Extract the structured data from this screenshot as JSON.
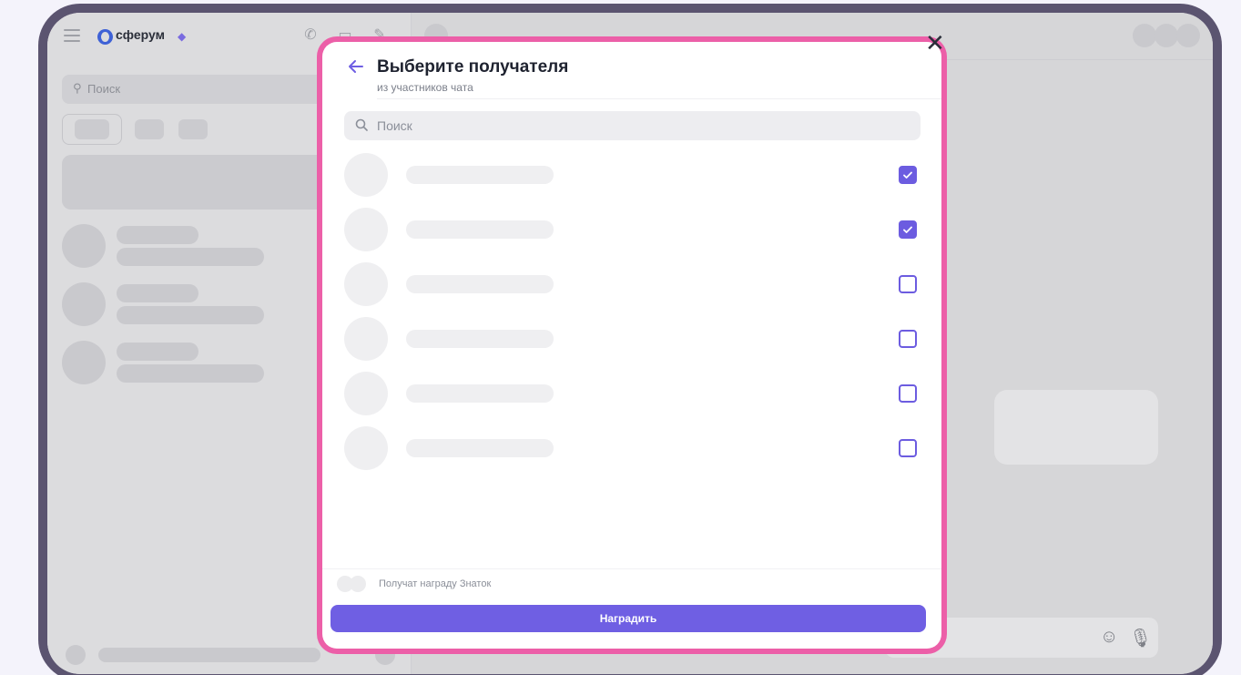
{
  "app": {
    "brand": "сферум",
    "search_placeholder": "Поиск"
  },
  "modal": {
    "title": "Выберите получателя",
    "subtitle": "из участников чата",
    "search_placeholder": "Поиск",
    "recipients": [
      {
        "checked": true
      },
      {
        "checked": true
      },
      {
        "checked": false
      },
      {
        "checked": false
      },
      {
        "checked": false
      },
      {
        "checked": false
      }
    ],
    "reward_label": "Получат награду Знаток",
    "award_button": "Наградить"
  },
  "colors": {
    "accent": "#6f5fe3",
    "highlight_frame": "#ec5fa8",
    "device_frame": "#5b5470"
  },
  "icons": {
    "back": "arrow-left-icon",
    "search": "search-icon",
    "close": "close-icon",
    "check": "check-icon",
    "emoji": "smile-icon",
    "mic": "microphone-icon"
  }
}
